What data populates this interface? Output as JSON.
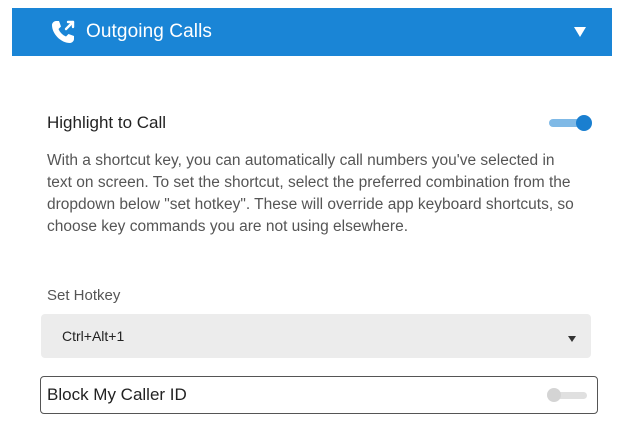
{
  "header": {
    "title": "Outgoing Calls",
    "icon": "phone-outgoing-icon",
    "caret_icon": "triangle-down-icon",
    "color": "#1a85d6"
  },
  "highlight_to_call": {
    "title": "Highlight to Call",
    "enabled": true,
    "description": "With a shortcut key, you can automatically call numbers you've selected in text on screen. To set the shortcut, select the preferred combination from the dropdown below \"set hotkey\". These will override app keyboard shortcuts, so choose key commands you are not using elsewhere.",
    "toggle_on_color": "#1a7fd0"
  },
  "hotkey": {
    "label": "Set Hotkey",
    "selected": "Ctrl+Alt+1"
  },
  "block_caller_id": {
    "label": "Block My Caller ID",
    "enabled": false
  }
}
